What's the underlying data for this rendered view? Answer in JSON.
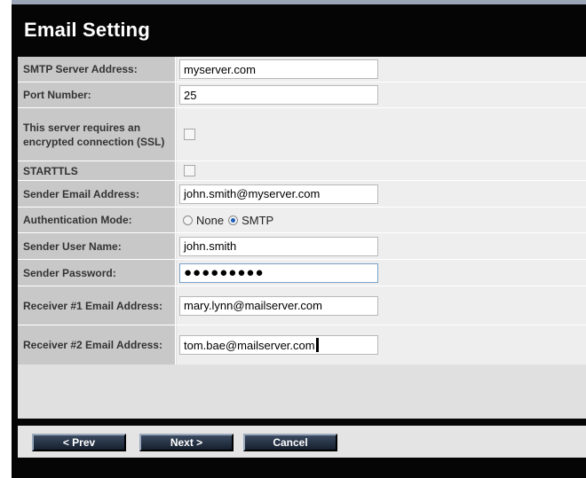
{
  "title": "Email Setting",
  "fields": {
    "smtp_server": {
      "label": "SMTP Server Address:",
      "value": "myserver.com"
    },
    "port": {
      "label": "Port Number:",
      "value": "25"
    },
    "ssl": {
      "label": "This server requires an encrypted connection (SSL)",
      "checked": false
    },
    "starttls": {
      "label": "STARTTLS",
      "checked": false
    },
    "sender_email": {
      "label": "Sender Email Address:",
      "value": "john.smith@myserver.com"
    },
    "auth_mode": {
      "label": "Authentication Mode:",
      "options": [
        "None",
        "SMTP"
      ],
      "selected": "SMTP"
    },
    "sender_user": {
      "label": "Sender User Name:",
      "value": "john.smith"
    },
    "sender_password": {
      "label": "Sender Password:",
      "masked": "●●●●●●●●●"
    },
    "receiver1": {
      "label": "Receiver #1 Email Address:",
      "value": "mary.lynn@mailserver.com"
    },
    "receiver2": {
      "label": "Receiver #2 Email Address:",
      "value": "tom.bae@mailserver.com"
    }
  },
  "buttons": {
    "prev": "< Prev",
    "next": "Next >",
    "cancel": "Cancel"
  }
}
